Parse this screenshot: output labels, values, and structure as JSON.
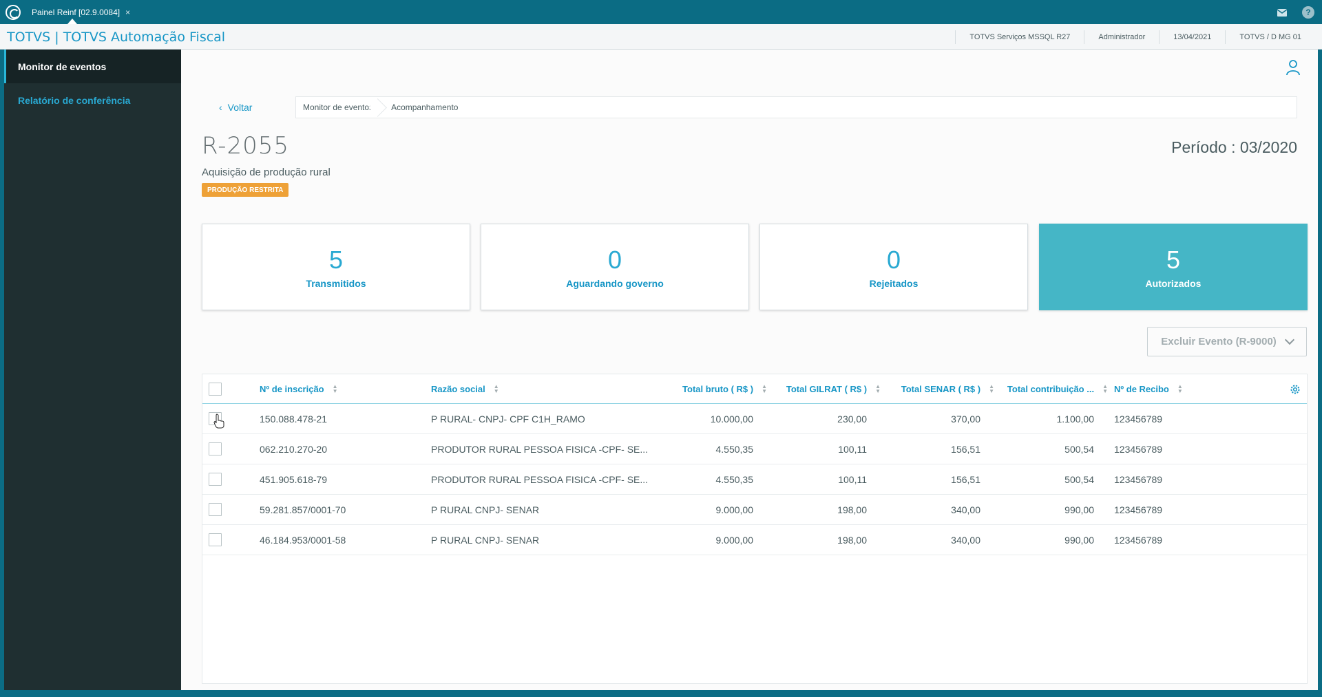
{
  "tab": {
    "title": "Painel Reinf [02.9.0084]",
    "close": "×"
  },
  "header": {
    "brand": "TOTVS | TOTVS Automação Fiscal",
    "server": "TOTVS Serviços MSSQL R27",
    "user": "Administrador",
    "date": "13/04/2021",
    "branch": "TOTVS / D MG 01"
  },
  "sidebar": {
    "items": [
      {
        "label": "Monitor de eventos",
        "active": true
      },
      {
        "label": "Relatório de conferência",
        "active": false
      }
    ]
  },
  "nav": {
    "back": "Voltar",
    "breadcrumb": [
      "Monitor de eventos",
      "Acompanhamento"
    ]
  },
  "event": {
    "code": "R-2055",
    "description": "Aquisição de produção rural",
    "environment": "PRODUÇÃO RESTRITA",
    "period": "Período : 03/2020"
  },
  "cards": [
    {
      "value": "5",
      "label": "Transmitidos"
    },
    {
      "value": "0",
      "label": "Aguardando governo"
    },
    {
      "value": "0",
      "label": "Rejeitados"
    },
    {
      "value": "5",
      "label": "Autorizados"
    }
  ],
  "actions": {
    "delete_event": "Excluir Evento (R-9000)"
  },
  "table": {
    "columns": [
      "Nº de inscrição",
      "Razão social",
      "Total bruto ( R$ )",
      "Total GILRAT ( R$ )",
      "Total SENAR ( R$ )",
      "Total contribuição ...",
      "Nº de Recibo"
    ],
    "rows": [
      [
        "150.088.478-21",
        "P RURAL- CNPJ- CPF C1H_RAMO",
        "10.000,00",
        "230,00",
        "370,00",
        "1.100,00",
        "123456789"
      ],
      [
        "062.210.270-20",
        "PRODUTOR RURAL PESSOA FISICA -CPF- SE...",
        "4.550,35",
        "100,11",
        "156,51",
        "500,54",
        "123456789"
      ],
      [
        "451.905.618-79",
        "PRODUTOR RURAL PESSOA FISICA -CPF- SE...",
        "4.550,35",
        "100,11",
        "156,51",
        "500,54",
        "123456789"
      ],
      [
        "59.281.857/0001-70",
        "P RURAL CNPJ- SENAR",
        "9.000,00",
        "198,00",
        "340,00",
        "990,00",
        "123456789"
      ],
      [
        "46.184.953/0001-58",
        "P RURAL CNPJ- SENAR",
        "9.000,00",
        "198,00",
        "340,00",
        "990,00",
        "123456789"
      ]
    ]
  },
  "colors": {
    "accent": "#1796c6",
    "topbar": "#0b6c84",
    "sidebar": "#1f2f31",
    "badge": "#eea137",
    "highlight_card": "#45b6c6"
  },
  "icons": [
    "totvs-logo-icon",
    "mail-icon",
    "help-icon",
    "user-icon",
    "chevron-left-icon",
    "chevron-down-icon",
    "sort-icon",
    "gear-icon",
    "pointer-cursor-icon"
  ]
}
